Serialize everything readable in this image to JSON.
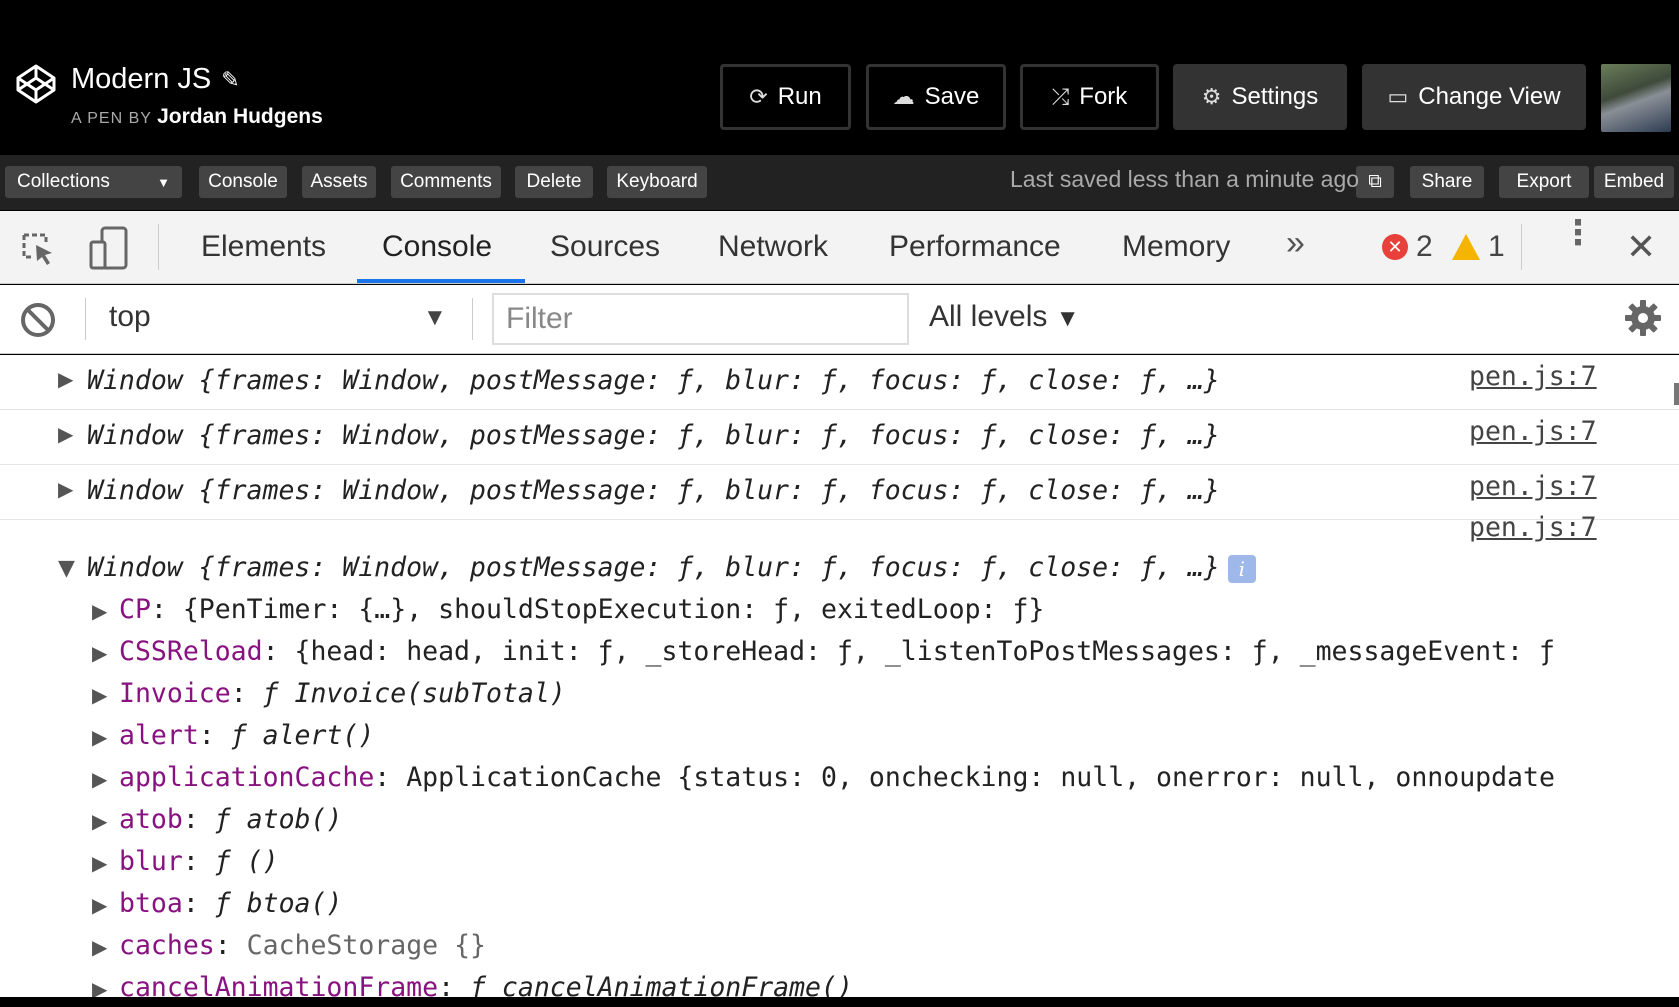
{
  "pen": {
    "title": "Modern JS",
    "byline_prefix": "A PEN BY",
    "author": "Jordan Hudgens"
  },
  "header_buttons": [
    {
      "label": "Run",
      "icon": "refresh-icon"
    },
    {
      "label": "Save",
      "icon": "cloud-icon"
    },
    {
      "label": "Fork",
      "icon": "fork-icon"
    },
    {
      "label": "Settings",
      "icon": "gear-icon"
    },
    {
      "label": "Change View",
      "icon": "view-icon"
    }
  ],
  "toolbar": {
    "collections": "Collections",
    "buttons": [
      "Console",
      "Assets",
      "Comments",
      "Delete",
      "Keyboard"
    ],
    "saved_status": "Last saved less than a minute ago",
    "right_buttons": [
      "Share",
      "Export",
      "Embed"
    ]
  },
  "devtools": {
    "tabs": [
      "Elements",
      "Console",
      "Sources",
      "Network",
      "Performance",
      "Memory"
    ],
    "active_tab": "Console",
    "more_tabs": "»",
    "error_count": "2",
    "warning_count": "1",
    "context": "top",
    "filter_placeholder": "Filter",
    "levels": "All levels"
  },
  "console": {
    "collapsed_log": "Window {frames: Window, postMessage: ƒ, blur: ƒ, focus: ƒ, close: ƒ, …}",
    "source": "pen.js:7",
    "info_badge": "i",
    "expanded_props": [
      {
        "name": "CP",
        "value": "{PenTimer: {…}, shouldStopExecution: ƒ, exitedLoop: ƒ}"
      },
      {
        "name": "CSSReload",
        "value": "{head: head, init: ƒ, _storeHead: ƒ, _listenToPostMessages: ƒ, _messageEvent: ƒ"
      },
      {
        "name": "Invoice",
        "value": "ƒ Invoice(subTotal)"
      },
      {
        "name": "alert",
        "value": "ƒ alert()"
      },
      {
        "name": "applicationCache",
        "value": "ApplicationCache {status: 0, onchecking: null, onerror: null, onnoupdate"
      },
      {
        "name": "atob",
        "value": "ƒ atob()"
      },
      {
        "name": "blur",
        "value": "ƒ ()"
      },
      {
        "name": "btoa",
        "value": "ƒ btoa()"
      },
      {
        "name": "caches",
        "value": "CacheStorage {}"
      },
      {
        "name": "cancelAnimationFrame",
        "value": "ƒ cancelAnimationFrame()"
      }
    ]
  },
  "colors": {
    "active_tab_underline": "#1a73e8",
    "property_name": "#881280",
    "function_keyword": "#1c00cf",
    "error_badge": "#e8403a",
    "warning_badge": "#f4b400"
  }
}
